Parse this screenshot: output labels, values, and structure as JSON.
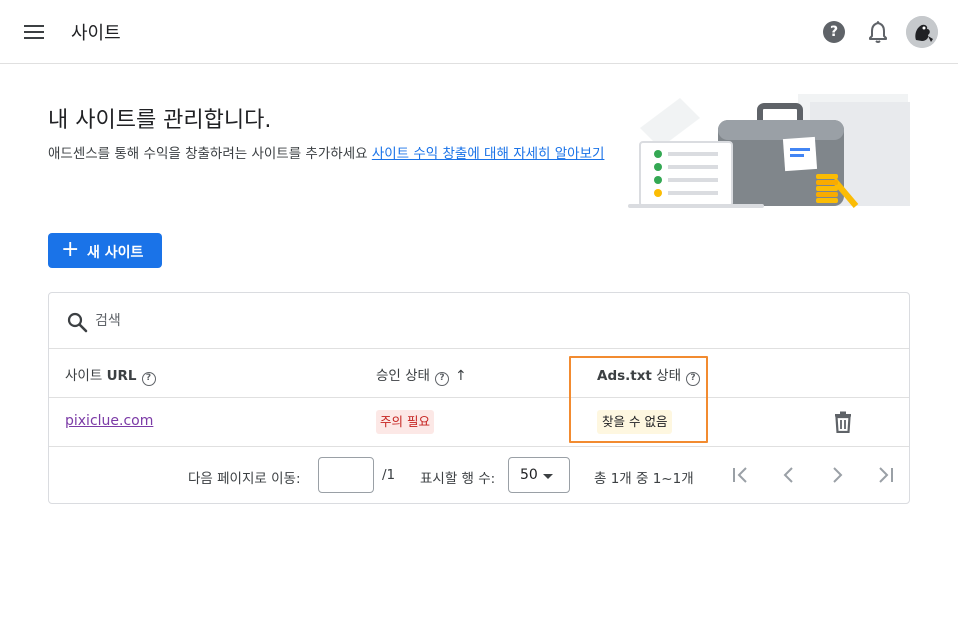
{
  "header": {
    "title": "사이트",
    "help_glyph": "?"
  },
  "intro": {
    "title": "내 사이트를 관리합니다.",
    "description": "애드센스를 통해 수익을 창출하려는 사이트를 추가하세요 ",
    "learn_more_link": "사이트 수익 창출에 대해 자세히 알아보기"
  },
  "new_site_button": {
    "icon": "+",
    "label": "새 사이트"
  },
  "search": {
    "placeholder": "검색"
  },
  "table": {
    "columns": {
      "site_url_prefix": "사이트 ",
      "site_url_bold": "URL",
      "approval_status": "승인 상태",
      "ads_txt_bold": "Ads.txt",
      "ads_txt_suffix": " 상태"
    },
    "rows": [
      {
        "site": "pixiclue.com",
        "approval_status": "주의 필요",
        "ads_txt_status": "찾을 수 없음"
      }
    ]
  },
  "footer": {
    "go_to_page_label": "다음 페이지로 이동:",
    "page_value": "",
    "page_total": "/1",
    "rows_per_page_label": "표시할 행 수:",
    "rows_per_page_value": "50",
    "range_text": "총 1개 중 1~1개"
  },
  "colors": {
    "primary": "#1a73e8",
    "warning_bg": "#fce8e6",
    "warning_text": "#c5221f",
    "ads_bg": "#fef7e0",
    "highlight": "#f28b30",
    "visited_link": "#7b3aa6"
  }
}
